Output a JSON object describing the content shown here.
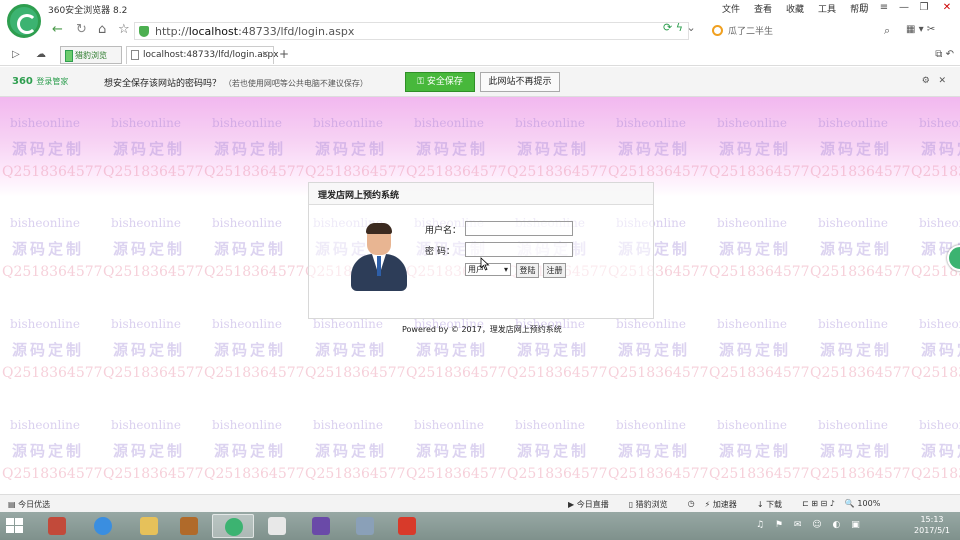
{
  "browser": {
    "title": "360安全浏览器 8.2",
    "menu": [
      "文件",
      "查看",
      "收藏",
      "工具",
      "帮助"
    ],
    "win_controls": [
      "▢",
      "≡",
      "—",
      "❐",
      "✕"
    ]
  },
  "address": {
    "url_prefix": "http://",
    "url_host": "localhost",
    "url_path": ":48733/lfd/login.aspx",
    "search_text": "瓜了二半生"
  },
  "tabs": {
    "secure_tab": "猎豹浏览",
    "active_tab": "localhost:48733/lfd/login.aspx"
  },
  "password_bar": {
    "brand": "360",
    "brand_sub": "登录管家",
    "message": "想安全保存该网站的密码吗？",
    "note": "（若也使用网吧等公共电脑不建议保存）",
    "save_label": "安全保存",
    "never_label": "此网站不再提示"
  },
  "watermark": {
    "site": "bisheonline",
    "custom": "源码定制",
    "qq": "Q2518364577"
  },
  "login": {
    "title": "理发店网上预约系统",
    "username_label": "用户名：",
    "password_label": "密  码：",
    "username_value": "",
    "password_value": "",
    "role_selected": "用户",
    "login_button": "登陆",
    "register_button": "注册",
    "powered": "Powered by © 2017，理发店网上预约系统"
  },
  "statusbar": {
    "left": "今日优选",
    "items": [
      "今日直播",
      "猎豹浏览",
      "加速器",
      "下载",
      "100%"
    ]
  },
  "taskbar": {
    "time": "15:13",
    "date": "2017/5/1",
    "tray_icons": "♫ ⚑ ✉ ☺ ◐ ▣"
  }
}
